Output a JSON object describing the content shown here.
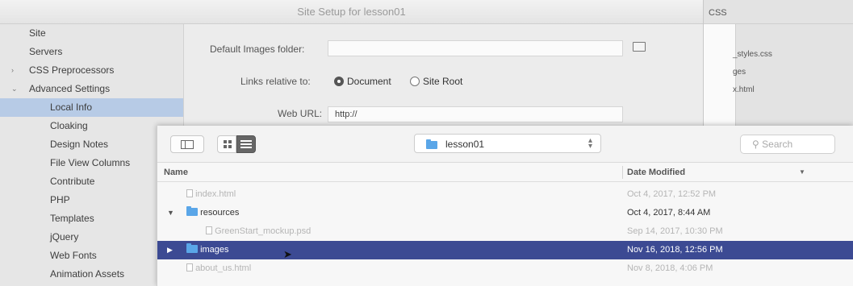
{
  "dialog": {
    "title": "Site Setup for lesson01",
    "sidebar": [
      {
        "label": "Site",
        "level": 0
      },
      {
        "label": "Servers",
        "level": 0
      },
      {
        "label": "CSS Preprocessors",
        "level": 0,
        "twisty": "›"
      },
      {
        "label": "Advanced Settings",
        "level": 0,
        "twisty": "⌄"
      },
      {
        "label": "Local Info",
        "level": 1,
        "selected": true
      },
      {
        "label": "Cloaking",
        "level": 1
      },
      {
        "label": "Design Notes",
        "level": 1
      },
      {
        "label": "File View Columns",
        "level": 1
      },
      {
        "label": "Contribute",
        "level": 1
      },
      {
        "label": "PHP",
        "level": 1
      },
      {
        "label": "Templates",
        "level": 1
      },
      {
        "label": "jQuery",
        "level": 1
      },
      {
        "label": "Web Fonts",
        "level": 1
      },
      {
        "label": "Animation Assets",
        "level": 1
      }
    ],
    "form": {
      "default_images_label": "Default Images folder:",
      "default_images_value": "",
      "links_relative_label": "Links relative to:",
      "radio_document": "Document",
      "radio_site_root": "Site Root",
      "web_url_label": "Web URL:",
      "web_url_value": "http://"
    }
  },
  "files_panel": {
    "title": "CSS",
    "files": [
      "_styles.css",
      "ges",
      "x.html"
    ]
  },
  "browser": {
    "current_folder": "lesson01",
    "search_placeholder": "Search",
    "columns": {
      "name": "Name",
      "date": "Date Modified"
    },
    "rows": [
      {
        "name": "index.html",
        "date": "Oct 4, 2017, 12:52 PM",
        "kind": "file",
        "enabled": false,
        "indent": 0
      },
      {
        "name": "resources",
        "date": "Oct 4, 2017, 8:44 AM",
        "kind": "folder",
        "enabled": true,
        "expanded": true,
        "indent": 0
      },
      {
        "name": "GreenStart_mockup.psd",
        "date": "Sep 14, 2017, 10:30 PM",
        "kind": "file",
        "enabled": false,
        "indent": 1
      },
      {
        "name": "images",
        "date": "Nov 16, 2018, 12:56 PM",
        "kind": "folder",
        "enabled": true,
        "selected": true,
        "indent": 0
      },
      {
        "name": "about_us.html",
        "date": "Nov 8, 2018, 4:06 PM",
        "kind": "file",
        "enabled": false,
        "indent": 0
      }
    ]
  },
  "colors": {
    "selection": "#3c4a93",
    "sidebar_selection": "#b7cbe6",
    "folder": "#5aa6e8"
  }
}
